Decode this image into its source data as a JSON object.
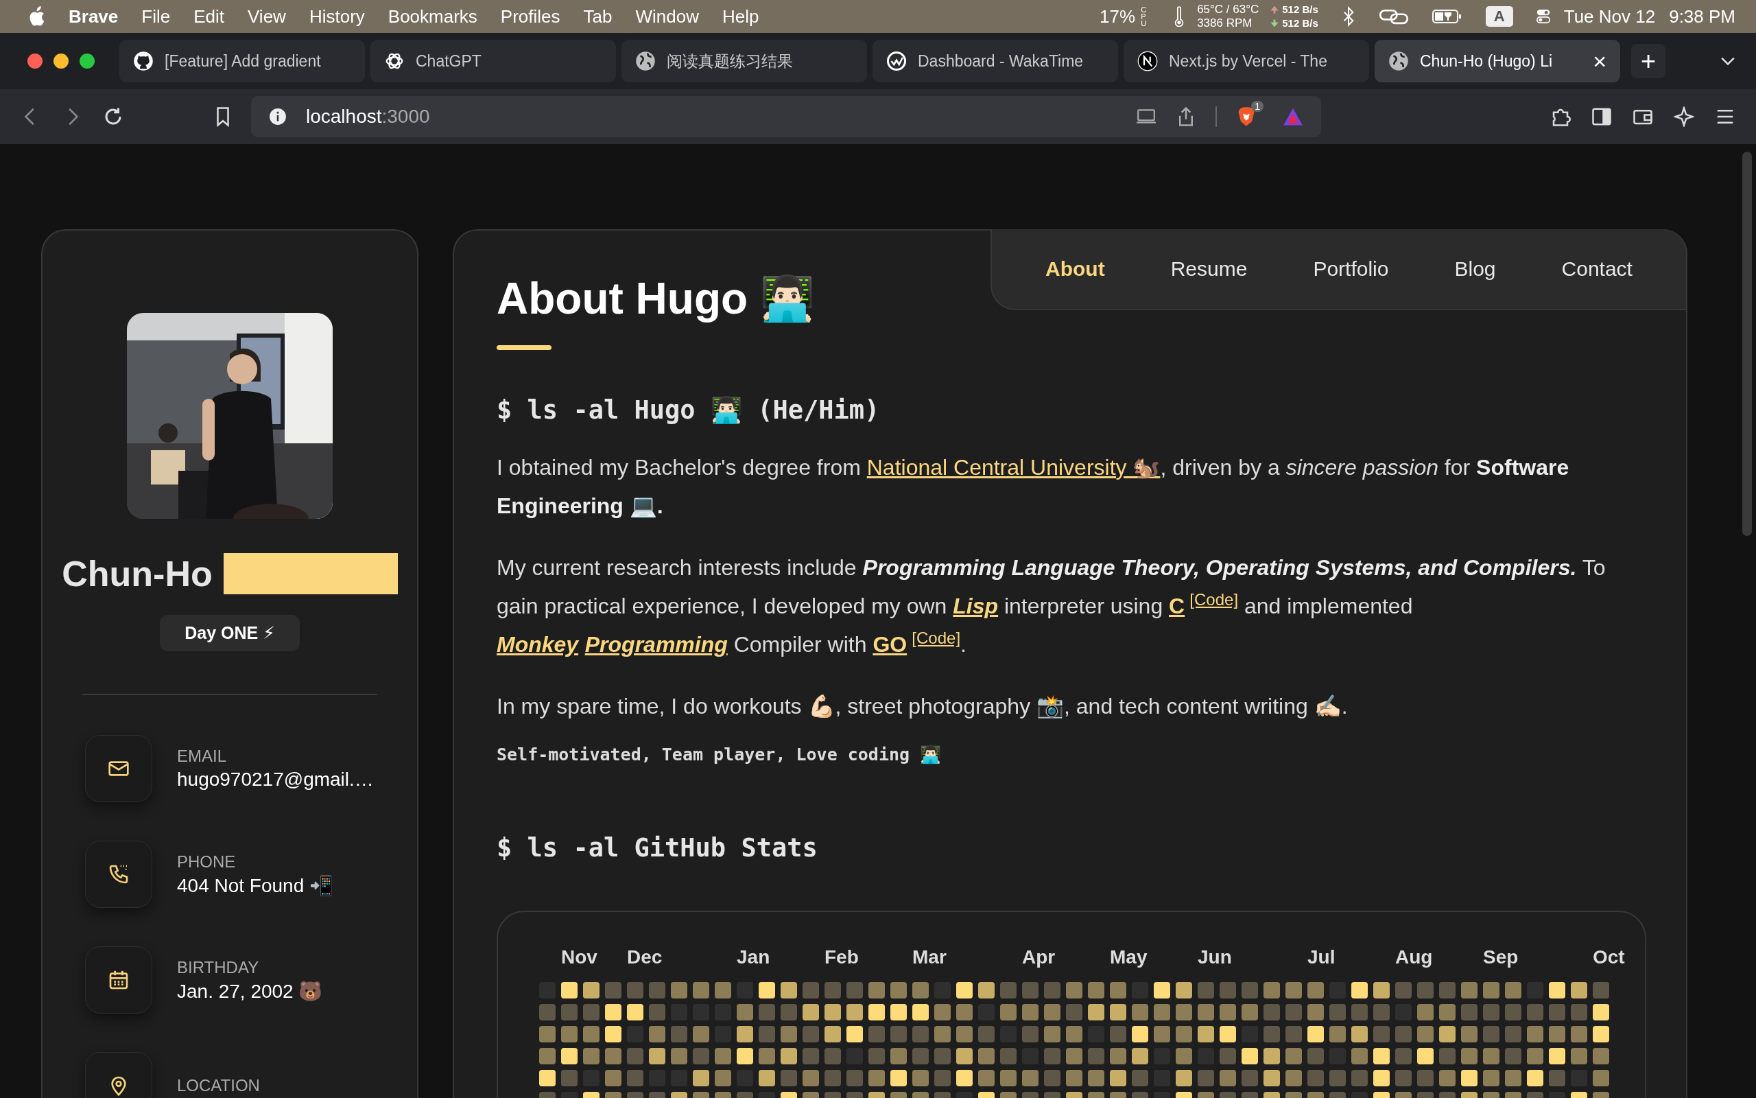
{
  "menu_bar": {
    "app": "Brave",
    "items": [
      "File",
      "Edit",
      "View",
      "History",
      "Bookmarks",
      "Profiles",
      "Tab",
      "Window",
      "Help"
    ],
    "cpu": "17%",
    "cpu_label": "CPU",
    "temperature": "65°C / 63°C",
    "fan": "3386 RPM",
    "upload": "512 B/s",
    "download": "512 B/s",
    "input_source": "A",
    "date": "Tue Nov 12",
    "time": "9:38 PM"
  },
  "tabs": [
    {
      "title": "[Feature] Add gradient",
      "selected": false
    },
    {
      "title": "ChatGPT",
      "selected": false
    },
    {
      "title": "阅读真题练习结果",
      "selected": false
    },
    {
      "title": "Dashboard - WakaTime",
      "selected": false
    },
    {
      "title": "Next.js by Vercel - The",
      "selected": false
    },
    {
      "title": "Chun-Ho (Hugo) Li",
      "selected": true,
      "close": "×"
    }
  ],
  "new_tab": "+",
  "address_bar": {
    "host": "localhost",
    "port": ":3000"
  },
  "shields_badge": "1",
  "profile": {
    "name": "Chun-Ho",
    "badge": "Day ONE ⚡"
  },
  "contacts": [
    {
      "kind": "email",
      "label": "EMAIL",
      "value": "hugo970217@gmail.…"
    },
    {
      "kind": "phone",
      "label": "PHONE",
      "value": "404 Not Found 📲"
    },
    {
      "kind": "birthday",
      "label": "BIRTHDAY",
      "value": "Jan. 27, 2002 🐻"
    },
    {
      "kind": "location",
      "label": "LOCATION"
    }
  ],
  "nav": [
    {
      "label": "About",
      "selected": true
    },
    {
      "label": "Resume",
      "selected": false
    },
    {
      "label": "Portfolio",
      "selected": false
    },
    {
      "label": "Blog",
      "selected": false
    },
    {
      "label": "Contact",
      "selected": false
    }
  ],
  "title": "About Hugo 👨🏻‍💻",
  "intro_heading": "$ ls -al Hugo 👨🏻‍💻 (He/Him)",
  "paragraphs": [
    [
      {
        "kind": "text",
        "text": "I obtained my Bachelor's degree from "
      },
      {
        "kind": "link",
        "text": "National Central University 🐿️"
      },
      {
        "kind": "text",
        "text": ", driven by a *sincere passion* for **Software Engineering 💻.**"
      }
    ],
    [
      {
        "kind": "text",
        "text": "My current research interests include "
      },
      {
        "kind": "emphasis",
        "text": "Programming Language Theory, Operating Systems, and Compilers."
      },
      {
        "kind": "text",
        "text": " To gain practical experience, I developed my own "
      },
      {
        "kind": "strong_link",
        "text": "Lisp"
      },
      {
        "kind": "text",
        "text": " interpreter using "
      },
      {
        "kind": "bold_link",
        "text": "C"
      },
      {
        "kind": "ref",
        "text": "[Code]"
      },
      {
        "kind": "text",
        "text": " and implemented "
      },
      {
        "kind": "strong_link",
        "text": "Monkey"
      },
      {
        "kind": "strong_link",
        "text": "Programming"
      },
      {
        "kind": "text",
        "text": " Compiler with "
      },
      {
        "kind": "bold_link",
        "text": "GO"
      },
      {
        "kind": "ref",
        "text": "[Code]"
      },
      {
        "kind": "text",
        "text": "."
      }
    ],
    [
      {
        "kind": "text",
        "text": "In my spare time, I do workouts 💪🏻, street photography 📸, and tech content writing ✍🏻."
      }
    ]
  ],
  "tagline": "Self-motivated, Team player, Love coding 👨🏻‍💻",
  "stats_heading": "$ ls -al GitHub Stats",
  "months": [
    "Nov",
    "Dec",
    "Jan",
    "Feb",
    "Mar",
    "Apr",
    "May",
    "Jun",
    "Jul",
    "Aug",
    "Sep",
    "Oct"
  ]
}
